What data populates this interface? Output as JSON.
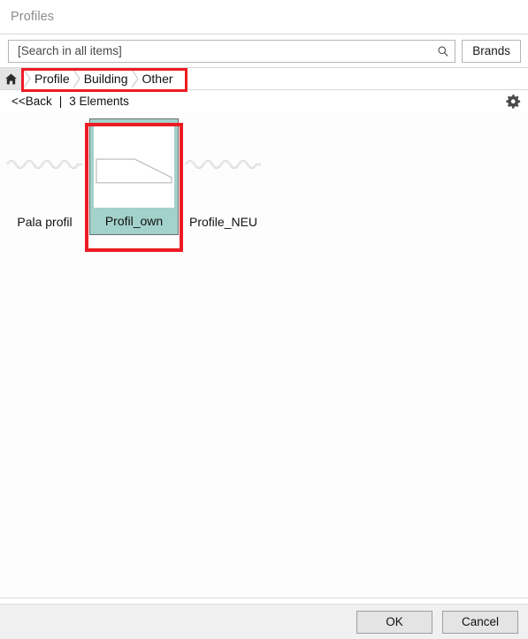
{
  "window": {
    "title": "Profiles"
  },
  "search": {
    "placeholder": "[Search in all items]",
    "value": "",
    "icon": "search-icon",
    "brands_label": "Brands"
  },
  "breadcrumb": {
    "home_icon": "home-icon",
    "items": [
      {
        "label": "Profile"
      },
      {
        "label": "Building"
      },
      {
        "label": "Other"
      }
    ],
    "highlight_color": "#ed1c24"
  },
  "toolbar": {
    "back_label": "<<Back",
    "separator": "|",
    "element_count": "3 Elements",
    "settings_icon": "gear-icon"
  },
  "grid": {
    "items": [
      {
        "label": "Pala profil",
        "thumbnail": "wave-placeholder-icon",
        "selected": false
      },
      {
        "label": "Profil_own",
        "thumbnail": "profile-shape-icon",
        "selected": true
      },
      {
        "label": "Profile_NEU",
        "thumbnail": "wave-placeholder-icon",
        "selected": false
      }
    ],
    "selected_color": "#a3d1cb"
  },
  "footer": {
    "ok_label": "OK",
    "cancel_label": "Cancel"
  }
}
